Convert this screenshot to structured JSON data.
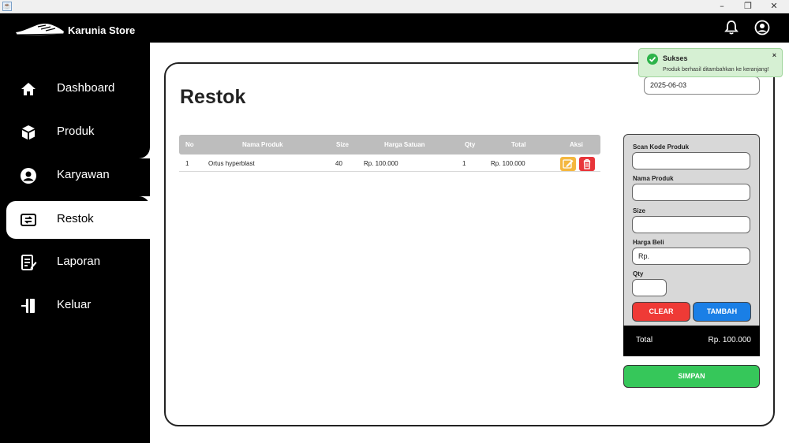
{
  "window": {
    "minimize": "–",
    "maximize": "❐",
    "close": "✕"
  },
  "header": {
    "brand": "Karunia Store"
  },
  "sidebar": {
    "items": [
      {
        "label": "Dashboard",
        "icon": "home-icon"
      },
      {
        "label": "Produk",
        "icon": "box-icon"
      },
      {
        "label": "Karyawan",
        "icon": "person-icon"
      },
      {
        "label": "Restok",
        "icon": "restock-icon",
        "active": true
      },
      {
        "label": "Laporan",
        "icon": "report-icon"
      },
      {
        "label": "Keluar",
        "icon": "exit-icon"
      }
    ]
  },
  "main": {
    "title": "Restok",
    "date": "2025-06-03"
  },
  "table": {
    "headers": [
      "No",
      "Nama Produk",
      "Size",
      "Harga Satuan",
      "Qty",
      "Total",
      "Aksi"
    ],
    "rows": [
      {
        "no": "1",
        "nama": "Ortus hyperblast",
        "size": "40",
        "harga": "Rp. 100.000",
        "qty": "1",
        "total": "Rp. 100.000"
      }
    ]
  },
  "form": {
    "scan_label": "Scan Kode Produk",
    "nama_label": "Nama Produk",
    "size_label": "Size",
    "harga_label": "Harga Beli",
    "harga_value": "Rp.",
    "qty_label": "Qty",
    "clear": "CLEAR",
    "tambah": "TAMBAH"
  },
  "summary": {
    "total_label": "Total",
    "total_value": "Rp. 100.000",
    "simpan": "SIMPAN"
  },
  "toast": {
    "title": "Sukses",
    "message": "Produk berhasil ditambahkan ke keranjang!",
    "close": "×"
  },
  "colors": {
    "sidebar": "#000000",
    "clear": "#ef3a36",
    "tambah": "#1a7fe6",
    "simpan": "#36c75a",
    "edit": "#f4b73f",
    "delete": "#e8353a"
  }
}
